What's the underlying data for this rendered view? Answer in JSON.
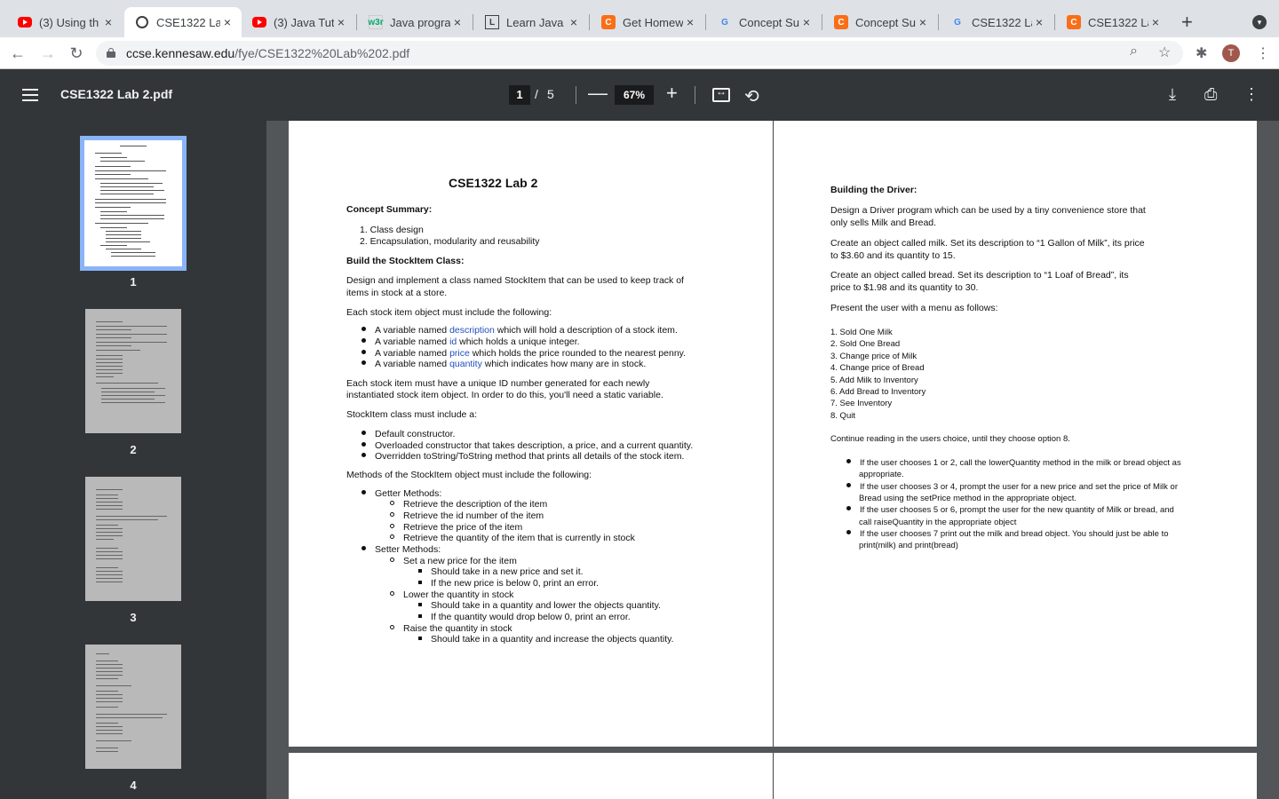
{
  "browser": {
    "tabs": [
      {
        "title": "(3) Using th",
        "favicon": "youtube-icon"
      },
      {
        "title": "CSE1322 La",
        "favicon": "globe-icon",
        "active": true
      },
      {
        "title": "(3) Java Tut",
        "favicon": "youtube-icon"
      },
      {
        "title": "Java progra",
        "favicon": "w3schools-icon"
      },
      {
        "title": "Learn Java",
        "favicon": "learnjava-icon"
      },
      {
        "title": "Get Homew",
        "favicon": "chegg-icon"
      },
      {
        "title": "Concept Su",
        "favicon": "google-icon"
      },
      {
        "title": "Concept Su",
        "favicon": "chegg-icon"
      },
      {
        "title": "CSE1322 La",
        "favicon": "google-icon"
      },
      {
        "title": "CSE1322 La",
        "favicon": "chegg-icon"
      }
    ],
    "favicon_labels": {
      "w3": "w3r",
      "chegg": "C",
      "google": "G",
      "learnjava": "L"
    },
    "close_glyph": "×",
    "new_tab": "+",
    "url_host": "ccse.kennesaw.edu",
    "url_path": "/fye/CSE1322%20Lab%202.pdf",
    "avatar_initial": "T"
  },
  "pdf_toolbar": {
    "doc_name": "CSE1322 Lab 2.pdf",
    "current_page": "1",
    "page_sep": "/",
    "total_pages": "5",
    "zoom": "67%",
    "zoom_out": "—",
    "zoom_in": "+"
  },
  "thumbnails": [
    {
      "label": "1",
      "active": true
    },
    {
      "label": "2",
      "active": false
    },
    {
      "label": "3",
      "active": false
    },
    {
      "label": "4",
      "active": false
    }
  ],
  "page1": {
    "title": "CSE1322 Lab 2",
    "concept_heading": "Concept Summary:",
    "concepts": [
      "1.  Class design",
      "2.  Encapsulation, modularity and reusability"
    ],
    "build_heading": "Build the StockItem Class:",
    "intro_1": "Design and implement a class named StockItem that can be used to keep track of",
    "intro_2": "items in stock at a store.",
    "each_include": "Each stock item object must include the following:",
    "vars": [
      {
        "pre": "A variable named ",
        "name": "description",
        "post": " which will hold a description of a stock item."
      },
      {
        "pre": "A variable named ",
        "name": "id",
        "post": " which holds a unique integer."
      },
      {
        "pre": "A variable named ",
        "name": "price",
        "post": " which holds the price rounded to the nearest penny."
      },
      {
        "pre": "A variable named ",
        "name": "quantity",
        "post": " which indicates how many are in stock."
      }
    ],
    "unique_1": "Each stock item must have a unique ID number generated for each newly",
    "unique_2": "instantiated stock item object.  In order to do this, you'll need a static variable.",
    "class_include": "StockItem class must include a:",
    "ctors": [
      "Default constructor.",
      "Overloaded constructor that takes description, a price, and a current  quantity.",
      "Overridden toString/ToString method that prints all details of the stock item."
    ],
    "methods_heading": "Methods of the StockItem object must include the following:",
    "getter_heading": "Getter Methods:",
    "getters": [
      "Retrieve the description of the item",
      "Retrieve the id number of the item",
      "Retrieve the price of the item",
      "Retrieve the quantity of the item that is currently in stock"
    ],
    "setter_heading": "Setter Methods:",
    "set_price": "Set a new price for the item",
    "set_price_details": [
      "Should take in a new price and set it.",
      "If the new price is below 0, print an error."
    ],
    "lower_qty": "Lower the quantity in stock",
    "lower_qty_details": [
      "Should take in a quantity and lower the objects quantity.",
      "If the quantity would drop below 0, print an error."
    ],
    "raise_qty": "Raise the quantity in stock",
    "raise_qty_details": [
      "Should take in a quantity and increase the objects quantity."
    ]
  },
  "page2": {
    "heading": "Building the Driver:",
    "p1_1": "Design a Driver program which can be used by a tiny convenience store that",
    "p1_2": "only sells Milk and Bread.",
    "p2_1": "Create an object called milk.  Set its description to “1 Gallon of Milk”, its price",
    "p2_2": "to $3.60 and its quantity to 15.",
    "p3_1": "Create an object called bread.  Set its description to “1 Loaf of Bread”, its",
    "p3_2": "price to $1.98 and its quantity to 30.",
    "menu_intro": "Present the user with a menu as follows:",
    "menu": [
      "1. Sold One Milk",
      "2. Sold One Bread",
      "3. Change price of Milk",
      "4. Change price of Bread",
      "5. Add Milk to Inventory",
      "6. Add Bread to Inventory",
      "7. See Inventory",
      "8. Quit"
    ],
    "continue": "Continue reading in the users choice, until they choose option 8.",
    "rules": [
      "If the user chooses 1 or 2, call the lowerQuantity method in the milk or bread object as",
      "appropriate.",
      "If the user chooses 3 or 4, prompt the user for a new price and set the price of Milk or",
      "Bread using the setPrice method in the appropriate object.",
      "If the user chooses 5 or 6, prompt the user for the new quantity of Milk or bread, and",
      "call raiseQuantity in the appropriate object",
      "If the user chooses 7 print out the milk and bread object.  You should just be able to",
      "print(milk) and print(bread)"
    ]
  }
}
